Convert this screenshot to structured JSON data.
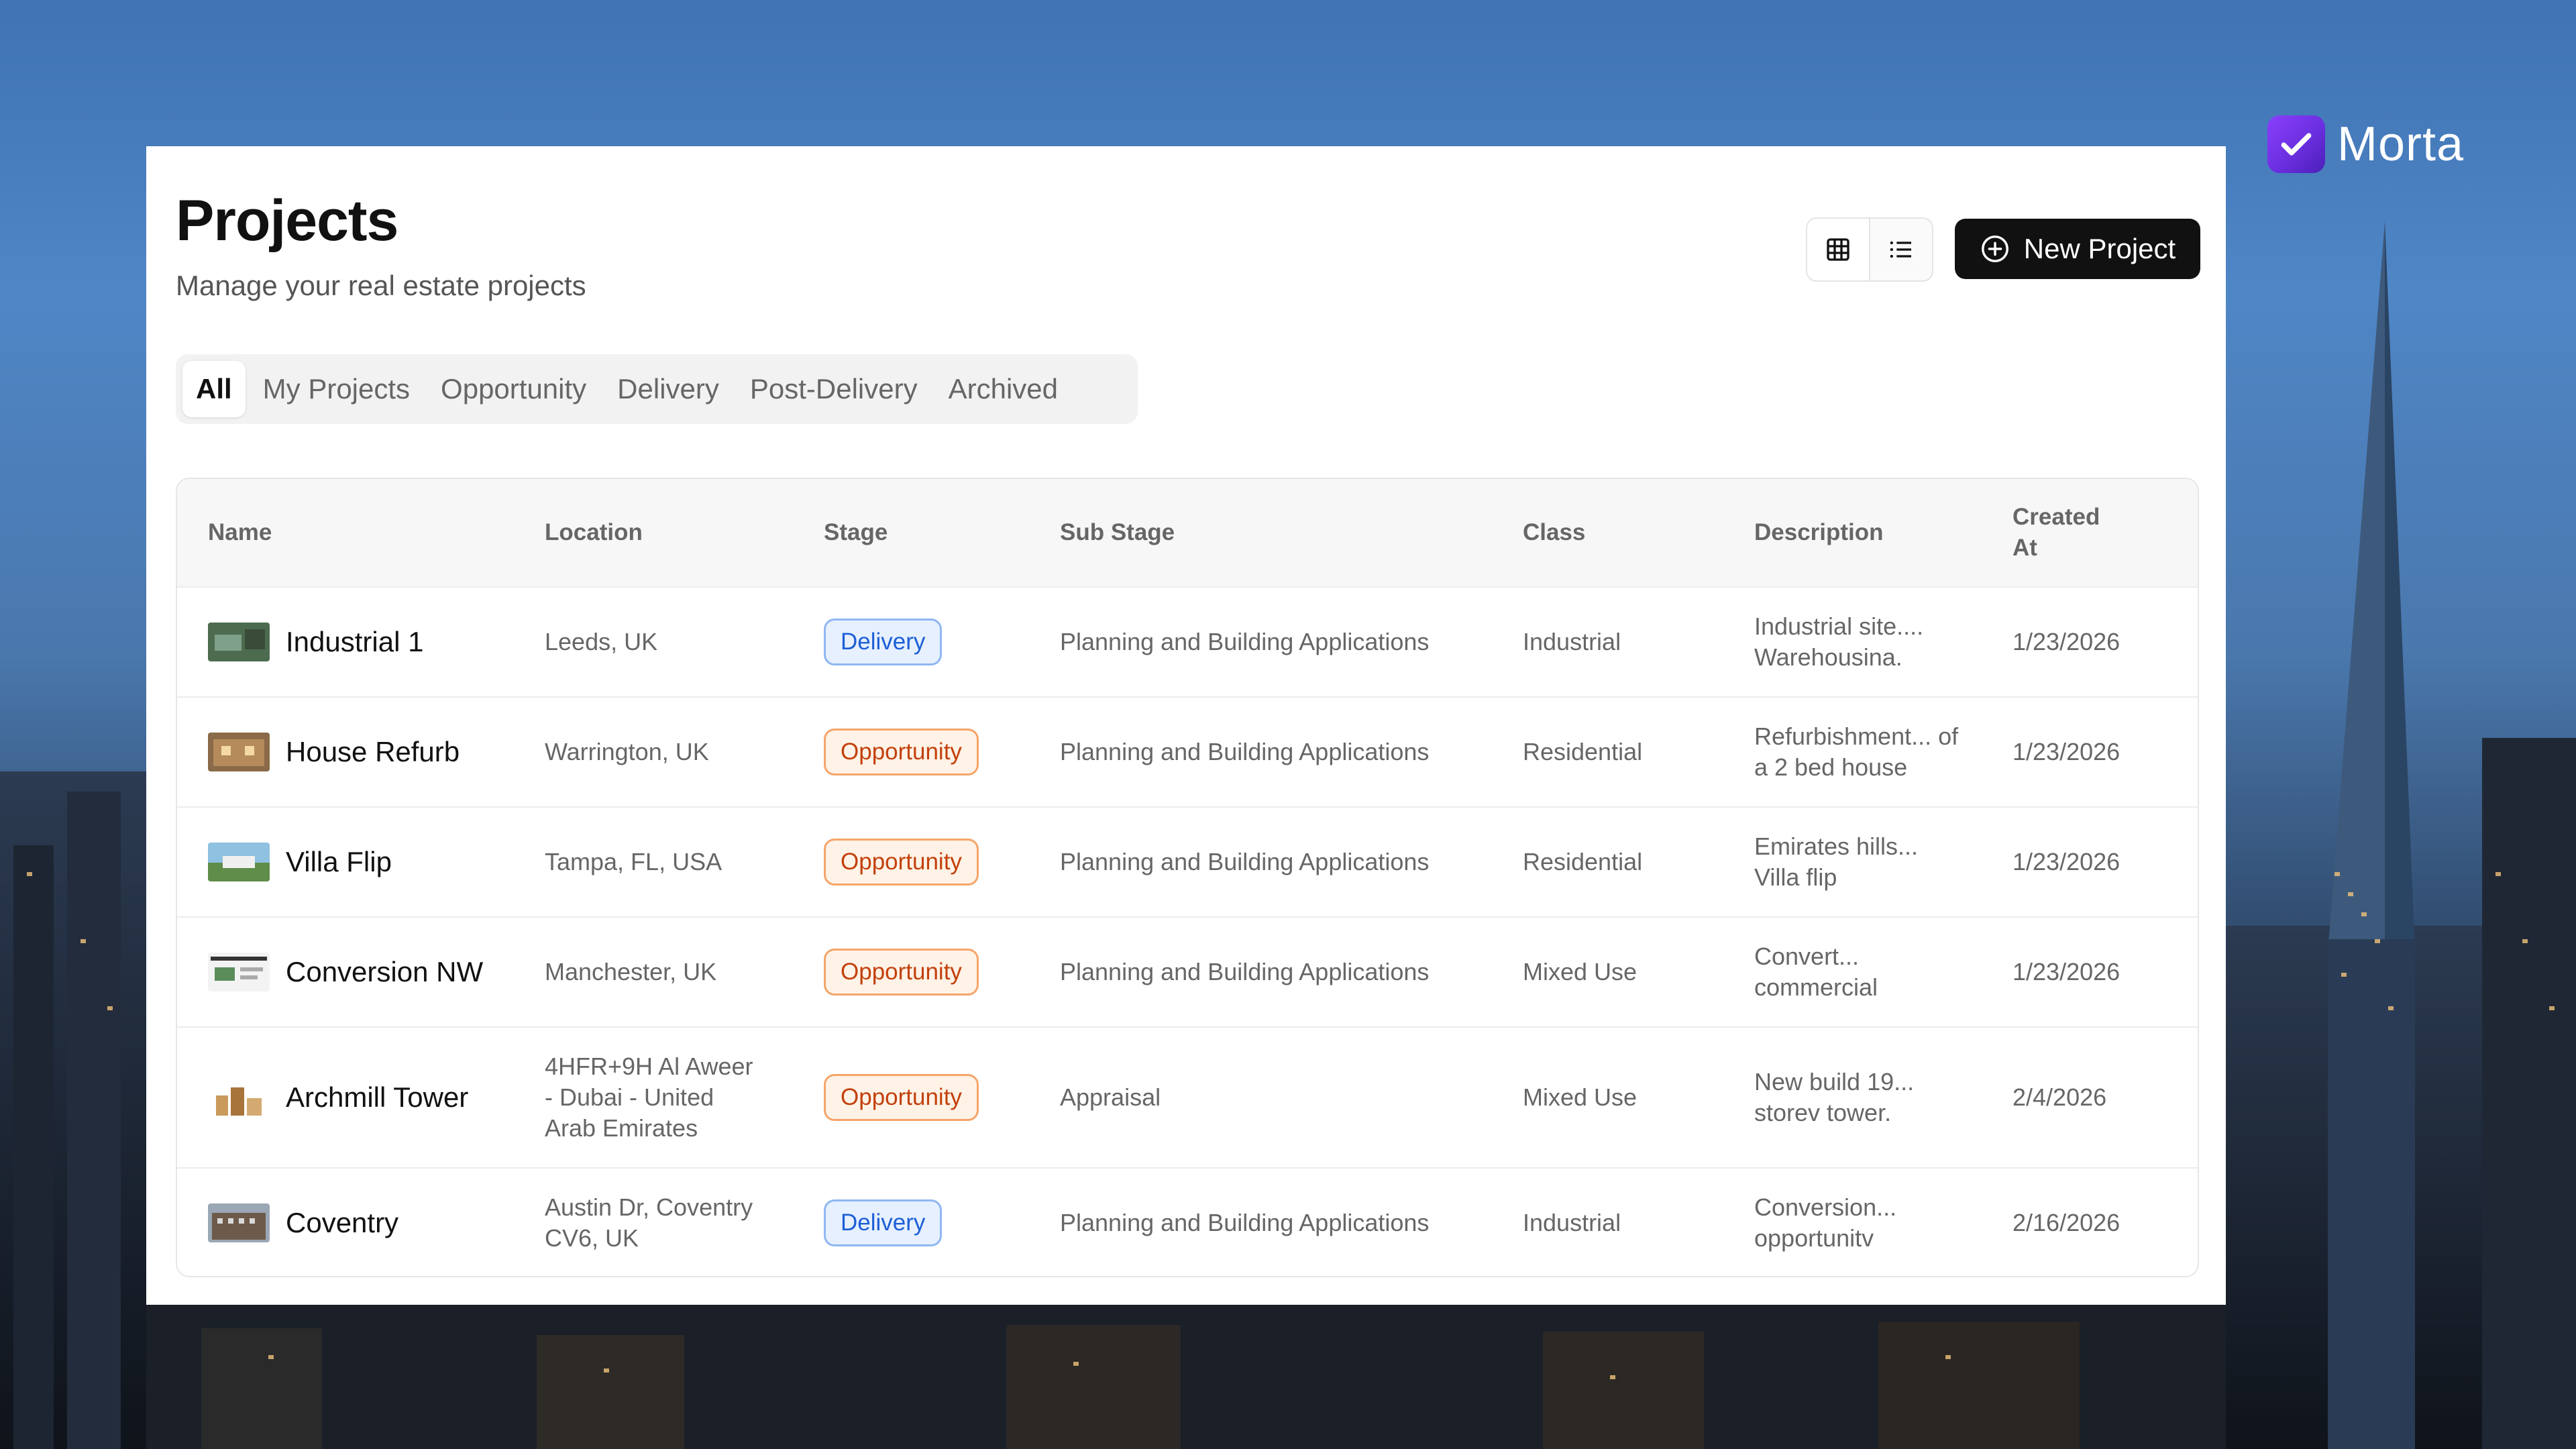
{
  "brand": {
    "name": "Morta",
    "accent": "#7a36f0"
  },
  "page": {
    "title": "Projects",
    "subtitle": "Manage your real estate projects"
  },
  "toolbar": {
    "grid_view_icon": "grid-icon",
    "list_view_icon": "list-icon",
    "new_project_label": "New Project",
    "new_project_icon": "plus-circle-icon"
  },
  "tabs": [
    {
      "label": "All",
      "active": true
    },
    {
      "label": "My Projects"
    },
    {
      "label": "Opportunity"
    },
    {
      "label": "Delivery"
    },
    {
      "label": "Post-Delivery"
    },
    {
      "label": "Archived"
    }
  ],
  "table": {
    "columns": [
      "Name",
      "Location",
      "Stage",
      "Sub Stage",
      "Class",
      "Description",
      "Created At"
    ],
    "rows": [
      {
        "name": "Industrial 1",
        "location": "Leeds, UK",
        "stage": "Delivery",
        "sub_stage": "Planning and Building Applications",
        "class": "Industrial",
        "description": "Industrial site.... Warehousina.",
        "created_at": "1/23/2026"
      },
      {
        "name": "House Refurb",
        "location": "Warrington, UK",
        "stage": "Opportunity",
        "sub_stage": "Planning and Building Applications",
        "class": "Residential",
        "description": "Refurbishment... of a 2 bed house",
        "created_at": "1/23/2026"
      },
      {
        "name": "Villa Flip",
        "location": "Tampa, FL, USA",
        "stage": "Opportunity",
        "sub_stage": "Planning and Building Applications",
        "class": "Residential",
        "description": "Emirates hills... Villa flip",
        "created_at": "1/23/2026"
      },
      {
        "name": "Conversion NW",
        "location": "Manchester, UK",
        "stage": "Opportunity",
        "sub_stage": "Planning and Building Applications",
        "class": "Mixed Use",
        "description": "Convert... commercial",
        "created_at": "1/23/2026"
      },
      {
        "name": "Archmill Tower",
        "location": "4HFR+9H Al Aweer - Dubai - United Arab Emirates",
        "stage": "Opportunity",
        "sub_stage": "Appraisal",
        "class": "Mixed Use",
        "description": "New build 19... storev tower.",
        "created_at": "2/4/2026"
      },
      {
        "name": "Coventry",
        "location": "Austin Dr, Coventry CV6, UK",
        "stage": "Delivery",
        "sub_stage": "Planning and Building Applications",
        "class": "Industrial",
        "description": "Conversion... opportunitv",
        "created_at": "2/16/2026"
      }
    ]
  }
}
